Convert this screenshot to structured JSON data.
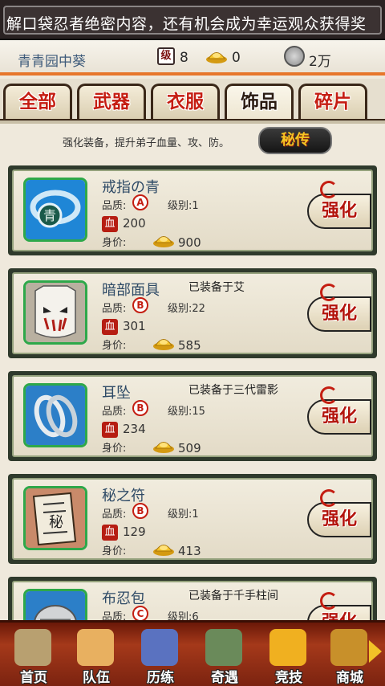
{
  "marquee": {
    "text": "解口袋忍者绝密内容，还有机会成为幸运观众获得奖"
  },
  "status": {
    "player_name": "青青园中葵",
    "level_icon": "级",
    "level": "8",
    "gold": "0",
    "silver": "2万",
    "icons": [
      "level-badge-icon",
      "gold-ingot-icon",
      "silver-coin-icon"
    ]
  },
  "tabs": [
    {
      "label": "全部",
      "active": false
    },
    {
      "label": "武器",
      "active": false
    },
    {
      "label": "衣服",
      "active": false
    },
    {
      "label": "饰品",
      "active": true
    },
    {
      "label": "碎片",
      "active": false
    }
  ],
  "hint": "强化装备，提升弟子血量、攻、防。",
  "quick_upgrade_label": "秘传",
  "labels": {
    "quality": "品质:",
    "level_prefix": "级别:",
    "hp_icon": "血",
    "price": "身价:",
    "upgrade": "强化"
  },
  "items": [
    {
      "name": "戒指の青",
      "equipped": "",
      "quality": "A",
      "level": "1",
      "hp": "200",
      "price": "900",
      "icon": "blue-ring-icon"
    },
    {
      "name": "暗部面具",
      "equipped": "已装备于艾",
      "quality": "B",
      "level": "22",
      "hp": "301",
      "price": "585",
      "icon": "anbu-mask-icon"
    },
    {
      "name": "耳坠",
      "equipped": "已装备于三代雷影",
      "quality": "B",
      "level": "15",
      "hp": "234",
      "price": "509",
      "icon": "earring-icon"
    },
    {
      "name": "秘之符",
      "equipped": "",
      "quality": "B",
      "level": "1",
      "hp": "129",
      "price": "413",
      "icon": "scroll-charm-icon"
    },
    {
      "name": "布忍包",
      "equipped": "已装备于千手柱间",
      "quality": "C",
      "level": "6",
      "hp": "",
      "price": "",
      "icon": "ninja-pouch-icon"
    }
  ],
  "nav": [
    {
      "label": "首页",
      "icon": "home-icon",
      "color": "#b8a070"
    },
    {
      "label": "队伍",
      "icon": "team-icon",
      "color": "#e8b060"
    },
    {
      "label": "历练",
      "icon": "kunai-icon",
      "color": "#5a72c0"
    },
    {
      "label": "奇遇",
      "icon": "adventure-icon",
      "color": "#6a8a5a"
    },
    {
      "label": "竞技",
      "icon": "vs-icon",
      "color": "#f0b020"
    },
    {
      "label": "商城",
      "icon": "shop-chest-icon",
      "color": "#c8902a"
    }
  ],
  "colors": {
    "accent": "#e7762b",
    "tab_text": "#c51d12",
    "nav_bg": "#a5391a"
  }
}
